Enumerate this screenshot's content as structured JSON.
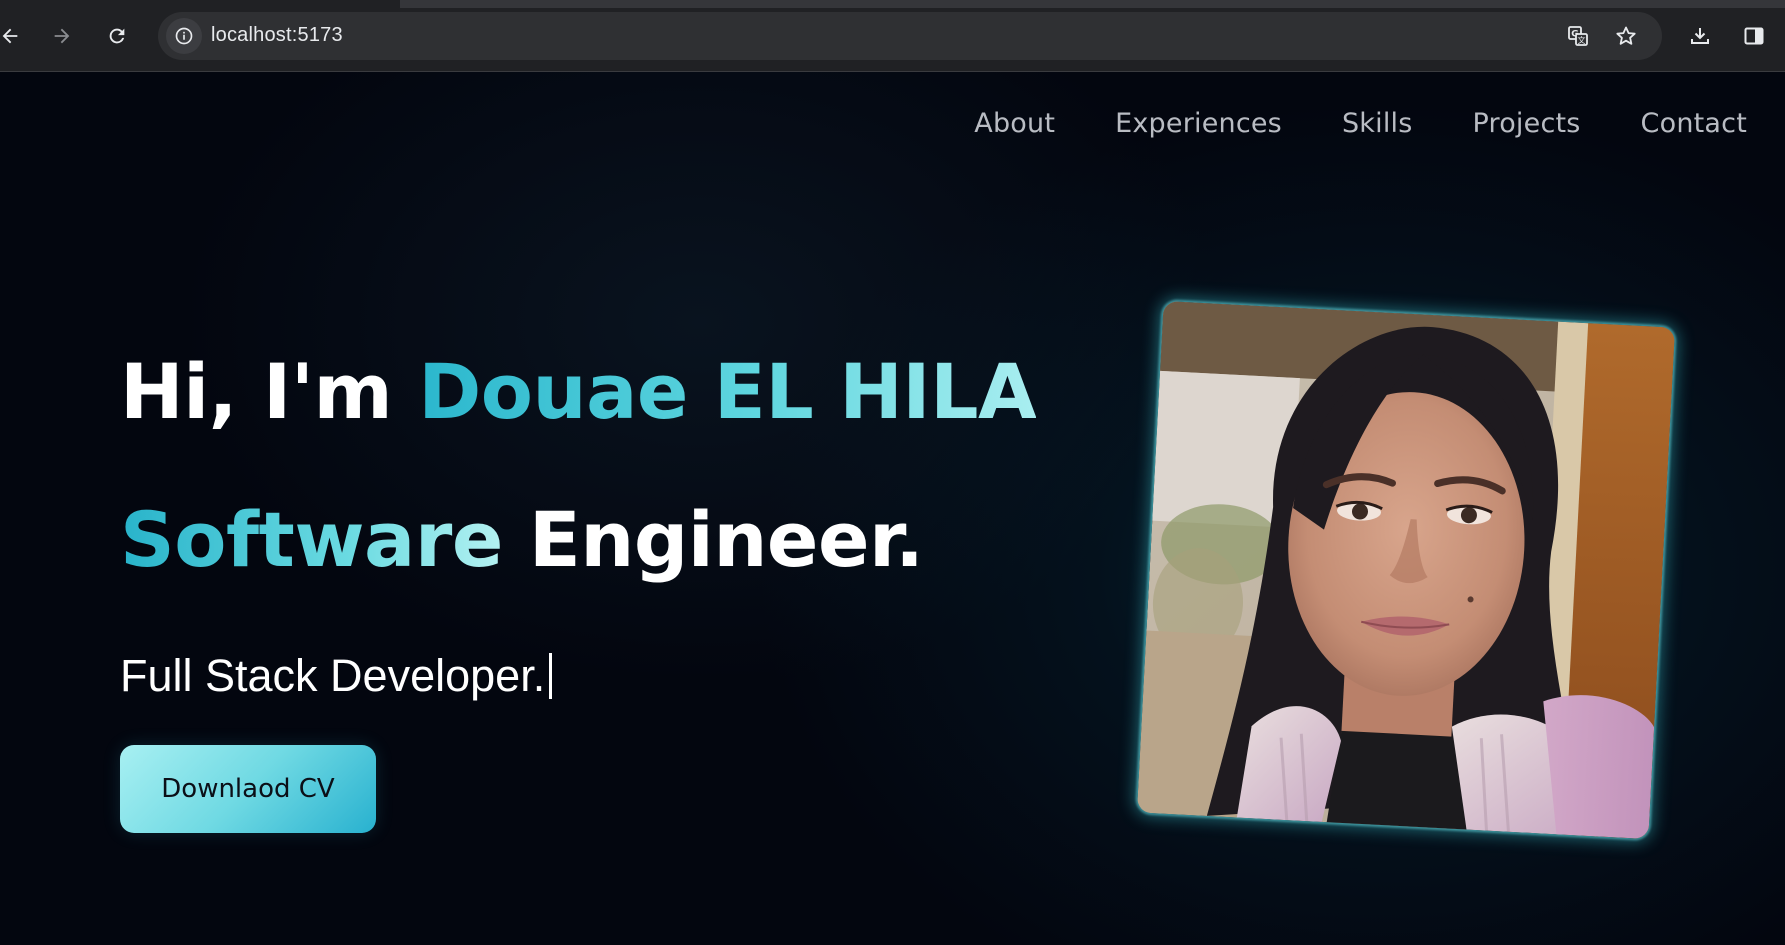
{
  "browser": {
    "url": "localhost:5173",
    "back_icon": "back-arrow-icon",
    "forward_icon": "forward-arrow-icon",
    "reload_icon": "reload-icon",
    "site_info_icon": "info-icon",
    "translate_icon": "translate-icon",
    "bookmark_icon": "star-icon",
    "download_icon": "download-icon",
    "side_panel_icon": "side-panel-icon"
  },
  "nav": {
    "items": [
      {
        "label": "About"
      },
      {
        "label": "Experiences"
      },
      {
        "label": "Skills"
      },
      {
        "label": "Projects"
      },
      {
        "label": "Contact"
      }
    ]
  },
  "hero": {
    "greeting": "Hi, I'm",
    "name": "Douae EL HILA",
    "role_highlight": "Software",
    "role_rest": "Engineer.",
    "typed_text": "Full Stack Developer.",
    "cv_button_label": "Downlaod CV",
    "photo_icon": "profile-photo"
  },
  "colors": {
    "background": "#03060f",
    "accent_start": "#2bb7cd",
    "accent_end": "#a9eef0",
    "nav_text": "#b9bcc3"
  }
}
